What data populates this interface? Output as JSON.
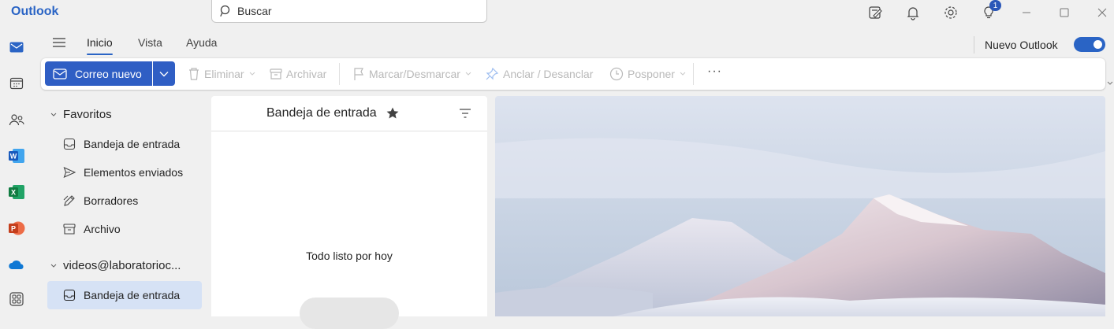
{
  "app": {
    "title": "Outlook"
  },
  "search": {
    "placeholder": "Buscar"
  },
  "titlebar": {
    "tips_badge": "1"
  },
  "ribbon": {
    "tabs": [
      {
        "label": "Inicio",
        "active": true
      },
      {
        "label": "Vista",
        "active": false
      },
      {
        "label": "Ayuda",
        "active": false
      }
    ],
    "new_outlook_label": "Nuevo Outlook",
    "new_outlook_enabled": true
  },
  "toolbar": {
    "new_mail_label": "Correo nuevo",
    "delete_label": "Eliminar",
    "archive_label": "Archivar",
    "flag_label": "Marcar/Desmarcar",
    "pin_label": "Anclar / Desanclar",
    "snooze_label": "Posponer",
    "more_label": "···"
  },
  "folders": {
    "favorites_label": "Favoritos",
    "favorites": [
      {
        "label": "Bandeja de entrada",
        "icon": "inbox-icon"
      },
      {
        "label": "Elementos enviados",
        "icon": "send-icon"
      },
      {
        "label": "Borradores",
        "icon": "draft-icon"
      },
      {
        "label": "Archivo",
        "icon": "archive-icon"
      }
    ],
    "account_label": "videos@laboratorioc...",
    "account_items": [
      {
        "label": "Bandeja de entrada",
        "icon": "inbox-icon",
        "selected": true
      }
    ]
  },
  "message_list": {
    "title": "Bandeja de entrada",
    "empty_text": "Todo listo por hoy"
  },
  "colors": {
    "accent": "#2f5ec4",
    "brand_text": "#2a64c5",
    "selected_folder": "#d6e2f5"
  }
}
